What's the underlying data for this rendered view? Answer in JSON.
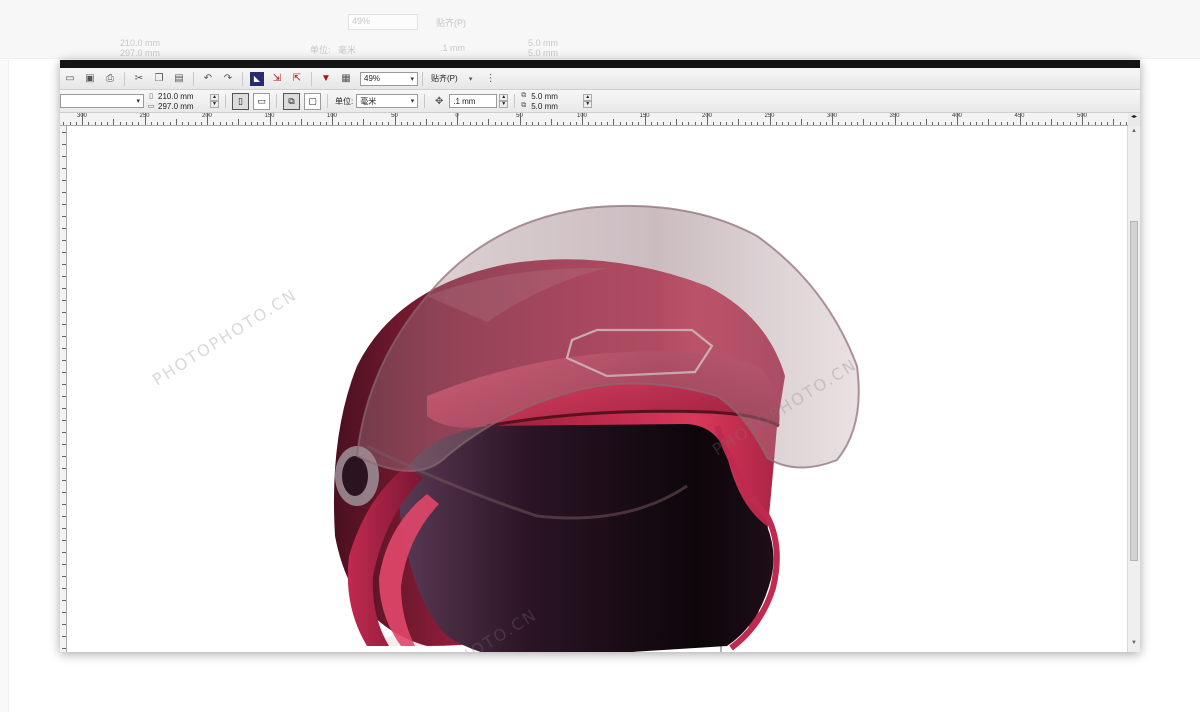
{
  "toolbar": {
    "zoom": "49%",
    "snap_label": "贴齐(P)",
    "page_width": "210.0 mm",
    "page_height": "297.0 mm",
    "units_label": "单位:",
    "units_value": "毫米",
    "nudge": ".1 mm",
    "dup_x": "5.0 mm",
    "dup_y": "5.0 mm"
  },
  "ruler": {
    "labels": [
      "300",
      "250",
      "200",
      "150",
      "100",
      "50",
      "0",
      "50",
      "100",
      "150",
      "200",
      "250",
      "300",
      "350",
      "400",
      "450",
      "500"
    ],
    "unit": "毫米"
  },
  "ghost": {
    "zoom": "49%",
    "snap_label": "贴齐(P)",
    "page_width": "210.0 mm",
    "page_height": "297.0 mm",
    "units_label": "单位:",
    "units_value": "毫米",
    "nudge": ".1 mm",
    "dup_x": "5.0 mm",
    "dup_y": "5.0 mm"
  },
  "watermark": {
    "text": "PHOTOPHOTO.CN"
  },
  "colors": {
    "helmet_red": "#b8284a",
    "helmet_highlight": "#e84a6c",
    "visor_tint": "#9c7c84",
    "interior_dark": "#1e0e18"
  },
  "icons": [
    "new-doc-icon",
    "open-icon",
    "save-icon",
    "print-icon",
    "cut-icon",
    "copy-icon",
    "paste-icon",
    "undo-icon",
    "redo-icon",
    "corel-app-icon",
    "import-icon",
    "export-icon",
    "publish-pdf-icon",
    "app-launcher-icon",
    "snap-options-icon",
    "portrait-icon",
    "landscape-icon",
    "all-pages-icon",
    "current-page-icon",
    "nudge-icon",
    "duplicate-distance-icon"
  ]
}
